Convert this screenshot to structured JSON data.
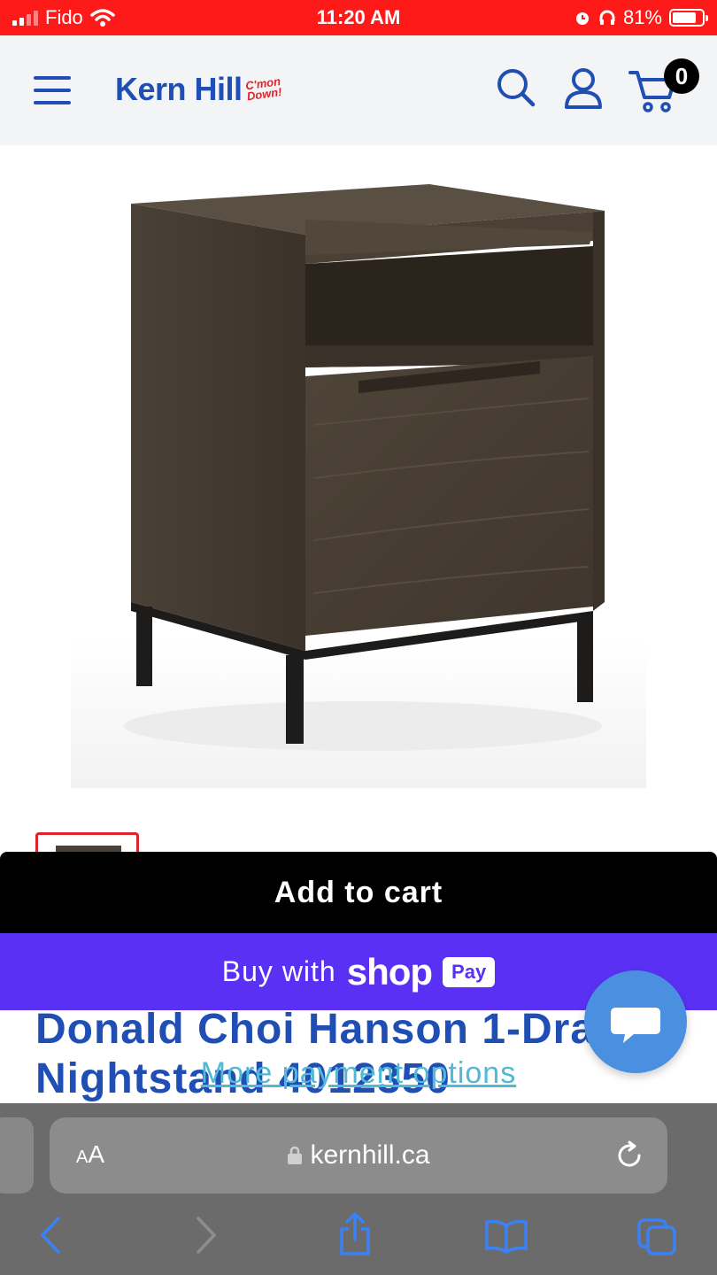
{
  "status_bar": {
    "carrier": "Fido",
    "time": "11:20 AM",
    "battery": "81%",
    "battery_level": 0.81,
    "color": "#ff1a1a"
  },
  "header": {
    "brand": "Kern Hill",
    "tagline": "C'mon Down!",
    "cart_count": "0",
    "icons": [
      "menu-icon",
      "search-icon",
      "account-icon",
      "cart-icon"
    ],
    "brand_color": "#1f4fb4"
  },
  "product": {
    "image": "dark wood nightstand with open shelf and one drawer on black metal legs",
    "title": "Donald Choi Hanson 1-Drawer Nightstand 4012350"
  },
  "buttons": {
    "add_to_cart": "Add to cart",
    "buy_with": "Buy with",
    "shop": "shop",
    "pay": "Pay",
    "more_options": "More payment options"
  },
  "browser": {
    "aa_label": "AA",
    "url": "kernhill.ca",
    "toolbar": [
      "back-icon",
      "forward-icon",
      "share-icon",
      "bookmarks-icon",
      "tabs-icon"
    ]
  }
}
